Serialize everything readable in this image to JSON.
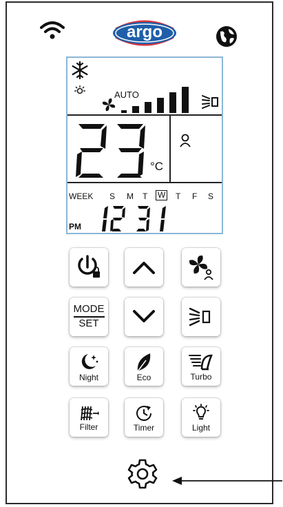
{
  "header": {
    "logo_text": "argo",
    "wifi_icon": "wifi-icon",
    "globe_icon": "globe-icon"
  },
  "display": {
    "mode_icon": "snowflake-icon",
    "fan_mode": "AUTO",
    "temperature": "23",
    "unit": "°C",
    "week_label": "WEEK",
    "days": [
      "S",
      "M",
      "T",
      "W",
      "T",
      "F",
      "S"
    ],
    "selected_day_index": 3,
    "ampm": "PM",
    "clock_hours": "12",
    "clock_minutes": "31",
    "fan_level_bars": 6
  },
  "buttons": {
    "mode_line1": "MODE",
    "mode_line2": "SET",
    "night": "Night",
    "eco": "Eco",
    "turbo": "Turbo",
    "filter": "Filter",
    "timer": "Timer",
    "light": "Light"
  },
  "colors": {
    "lcd_border": "#8ab6d6",
    "logo_blue": "#1f5fa8",
    "logo_red": "#d8343c"
  }
}
